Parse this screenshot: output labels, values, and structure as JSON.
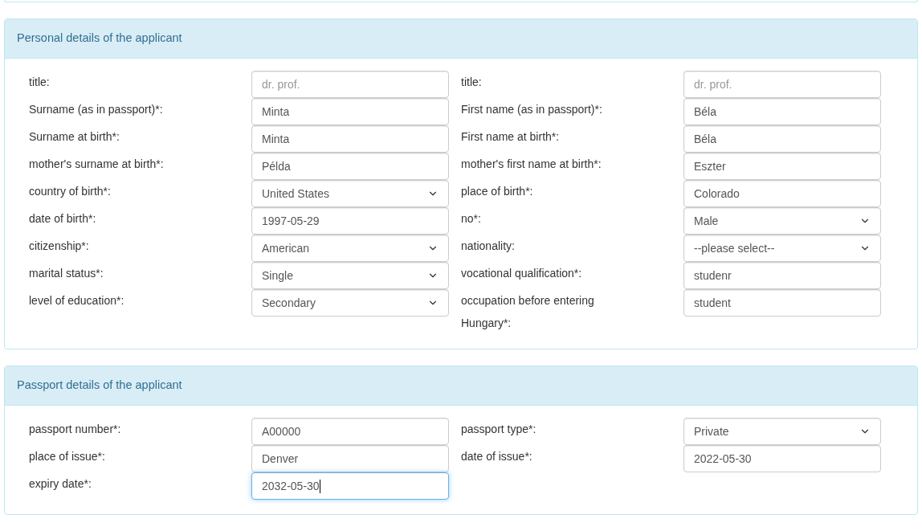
{
  "panels": [
    {
      "title": "Personal details of the applicant",
      "columns": [
        [
          {
            "label": "title:",
            "kind": "text",
            "placeholder": "dr.  prof.",
            "focused": false
          },
          {
            "label": "Surname (as in passport)*:",
            "kind": "text",
            "value": "Minta",
            "focused": false
          },
          {
            "label": "Surname at birth*:",
            "kind": "text",
            "value": "Minta",
            "focused": false
          },
          {
            "label": "mother's surname at birth*:",
            "kind": "text",
            "value": "Példa",
            "focused": false
          },
          {
            "label": "country of birth*:",
            "kind": "select",
            "value": "United States",
            "focused": false
          },
          {
            "label": "date of birth*:",
            "kind": "text",
            "value": "1997-05-29",
            "focused": false
          },
          {
            "label": "citizenship*:",
            "kind": "select",
            "value": "American",
            "focused": false
          },
          {
            "label": "marital status*:",
            "kind": "select",
            "value": "Single",
            "focused": false
          },
          {
            "label": "level of education*:",
            "kind": "select",
            "value": "Secondary",
            "focused": false
          }
        ],
        [
          {
            "label": "title:",
            "kind": "text",
            "placeholder": "dr.  prof.",
            "focused": false
          },
          {
            "label": "First name (as in passport)*:",
            "kind": "text",
            "value": "Béla",
            "focused": false
          },
          {
            "label": "First name at birth*:",
            "kind": "text",
            "value": "Béla",
            "focused": false
          },
          {
            "label": "mother's first name at birth*:",
            "kind": "text",
            "value": "Eszter",
            "focused": false
          },
          {
            "label": "place of birth*:",
            "kind": "text",
            "value": "Colorado",
            "focused": false
          },
          {
            "label": "no*:",
            "kind": "select",
            "value": "Male",
            "focused": false
          },
          {
            "label": "nationality:",
            "kind": "select",
            "value": "--please select--",
            "focused": false
          },
          {
            "label": "vocational qualification*:",
            "kind": "text",
            "value": "studenr",
            "focused": false
          },
          {
            "label": "occupation before entering Hungary*:",
            "kind": "text",
            "value": "student",
            "focused": false
          }
        ]
      ]
    },
    {
      "title": "Passport details of the applicant",
      "columns": [
        [
          {
            "label": "passport number*:",
            "kind": "text",
            "value": "A00000",
            "focused": false
          },
          {
            "label": "place of issue*:",
            "kind": "text",
            "value": "Denver",
            "focused": false
          },
          {
            "label": "expiry date*:",
            "kind": "text",
            "value": "2032-05-30",
            "focused": true
          }
        ],
        [
          {
            "label": "passport type*:",
            "kind": "select",
            "value": "Private",
            "focused": false
          },
          {
            "label": "date of issue*:",
            "kind": "text",
            "value": "2022-05-30",
            "focused": false
          }
        ]
      ]
    }
  ]
}
